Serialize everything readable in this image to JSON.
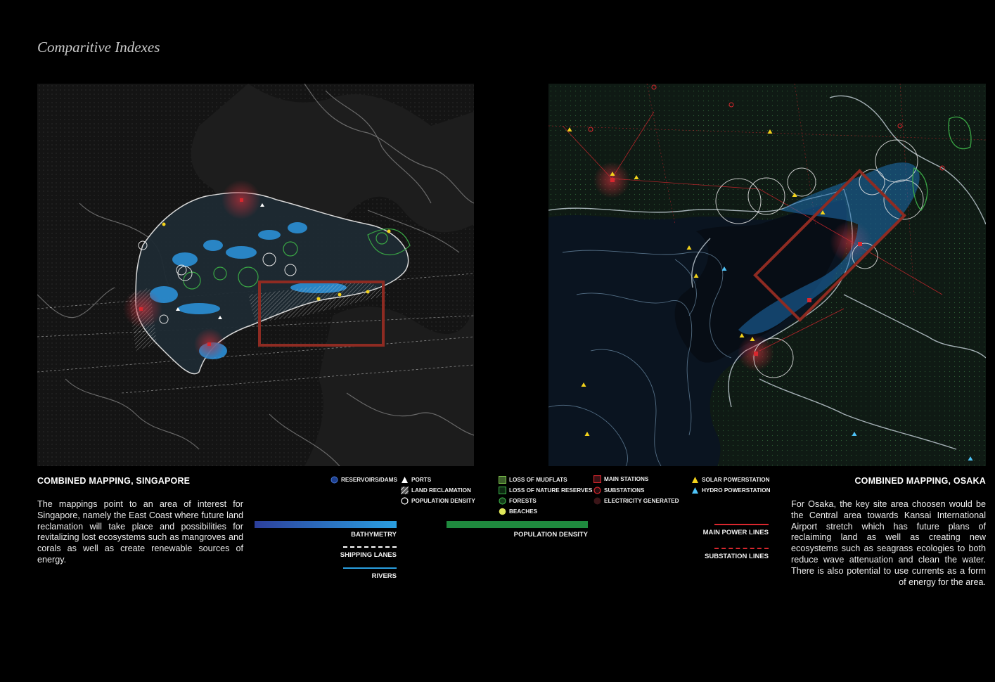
{
  "page": {
    "title": "Comparitive Indexes"
  },
  "singapore": {
    "heading": "COMBINED MAPPING, SINGAPORE",
    "body": "The mappings point to an area of interest for Singapore, namely the East Coast where future land reclamation will take place and possibilities for revitalizing lost ecosystems such as mangroves and corals as well as create renewable sources of energy."
  },
  "osaka": {
    "heading": "COMBINED MAPPING, OSAKA",
    "body": "For Osaka, the key site area choosen would be the Central area towards Kansai International Airport stretch which has future plans of reclaiming land as well as creating new ecosystems such as seagrass ecologies to both reduce wave attenuation and clean the water. There is also potential to use currents as a form of energy for the area."
  },
  "legend": {
    "reservoirs": "RESERVOIRS/DAMS",
    "ports": "PORTS",
    "land_reclamation": "LAND RECLAMATION",
    "population_density_point": "POPULATION DENSITY",
    "loss_of_mudflats": "LOSS OF MUDFLATS",
    "loss_of_nature_reserves": "LOSS OF NATURE RESERVES",
    "forests": "FORESTS",
    "beaches": "BEACHES",
    "main_stations": "MAIN STATIONS",
    "substations": "SUBSTATIONS",
    "electricity_generated": "ELECTRICITY GENERATED",
    "solar_powerstation": "SOLAR POWERSTATION",
    "hydro_powerstation": "HYDRO POWERSTATION",
    "bathymetry": "BATHYMETRY",
    "shipping_lanes": "SHIPPING LANES",
    "rivers": "RIVERS",
    "population_density_bar": "POPULATION DENSITY",
    "main_power_lines": "MAIN POWER LINES",
    "substation_lines": "SUBSTATION LINES"
  },
  "colors": {
    "background": "#000000",
    "water_blue": "#2b8fd6",
    "river_blue": "#2a9fe0",
    "forest_green": "#2e8b3a",
    "power_red": "#d9272e",
    "solar_yellow": "#f2d21b",
    "hydro_blue": "#4fc3f7",
    "focus_box": "#8e2b22"
  },
  "icons": {
    "reservoirs": "blue-circle-icon",
    "ports": "triangle-icon",
    "land_reclamation": "hatched-square-icon",
    "population_density_point": "open-circle-icon",
    "loss_of_mudflats": "green-square-icon",
    "loss_of_nature_reserves": "outlined-green-square-icon",
    "forests": "green-ring-icon",
    "beaches": "yellow-dot-icon",
    "main_stations": "red-square-icon",
    "substations": "red-ring-icon",
    "electricity_generated": "dark-red-disc-icon",
    "solar_powerstation": "yellow-triangle-icon",
    "hydro_powerstation": "blue-triangle-icon"
  }
}
